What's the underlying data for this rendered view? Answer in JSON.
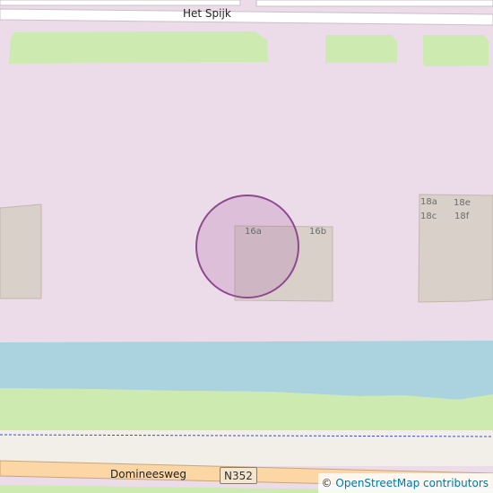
{
  "map": {
    "streets": {
      "top": "Het Spijk",
      "bottom": "Domineesweg"
    },
    "road_ref": "N352",
    "house_numbers": {
      "a16": "16a",
      "b16": "16b",
      "a18": "18a",
      "c18": "18c",
      "e18": "18e",
      "f18": "18f"
    },
    "marker": {
      "type": "location-circle",
      "color": "#8e4a8f"
    },
    "colors": {
      "residential": "#ecdbe8",
      "grass": "#cdebb0",
      "water": "#aad3df",
      "road": "#fcd6a4",
      "building": "#d9d0c9"
    }
  },
  "attribution": {
    "symbol": "©",
    "text": "OpenStreetMap contributors"
  }
}
